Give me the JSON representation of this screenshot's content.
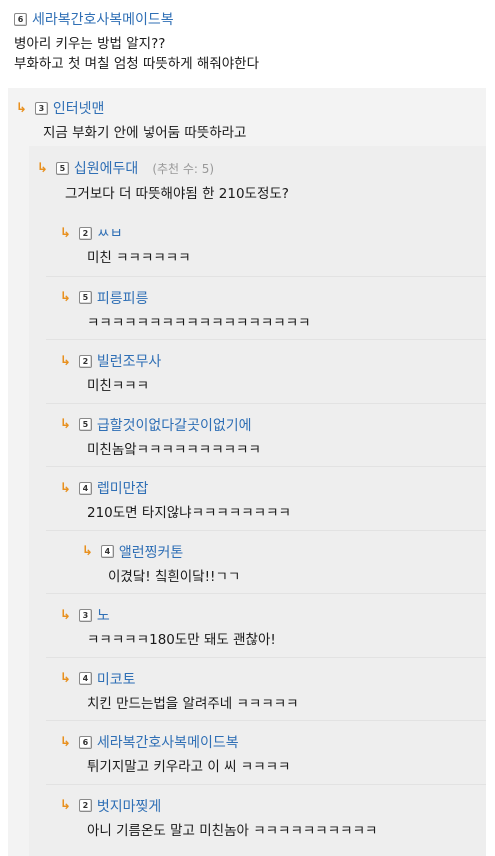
{
  "post": {
    "level": "6",
    "author": "세라복간호사복메이드복",
    "lines": [
      "병아리 키우는 방법 알지??",
      "부화하고 첫 며칠 엄청 따뜻하게 해줘야한다"
    ]
  },
  "reply": {
    "level": "3",
    "author": "인터넷맨",
    "text": "지금 부화기 안에 넣어둠 따뜻하라고"
  },
  "reply2": {
    "level": "5",
    "author": "십원에두대",
    "score": "(추천 수: 5)",
    "text": "그거보다 더 따뜻해야됨 한 210도정도?"
  },
  "replies": [
    {
      "level": "2",
      "author": "ㅆㅂ",
      "text": "미친 ㅋㅋㅋㅋㅋㅋ"
    },
    {
      "level": "5",
      "author": "피릉피릉",
      "text": "ㅋㅋㅋㅋㅋㅋㅋㅋㅋㅋㅋㅋㅋㅋㅋㅋㅋㅋ"
    },
    {
      "level": "2",
      "author": "빌런조무사",
      "text": "미친ㅋㅋㅋ"
    },
    {
      "level": "5",
      "author": "급할것이없다갈곳이없기에",
      "text": "미친놈앜ㅋㅋㅋㅋㅋㅋㅋㅋㅋㅋ"
    },
    {
      "level": "4",
      "author": "렙미만잡",
      "text": "210도면 타지않냐ㅋㅋㅋㅋㅋㅋㅋㅋ"
    },
    {
      "level": "4",
      "author": "앨런찡커톤",
      "text": "이겼닼! 칰흰이닼!!ㄱㄱ",
      "nested": true
    },
    {
      "level": "3",
      "author": "노",
      "text": "ㅋㅋㅋㅋㅋ180도만 돼도 괜찮아!"
    },
    {
      "level": "4",
      "author": "미코토",
      "text": "치킨 만드는법을 알려주네  ㅋㅋㅋㅋㅋ"
    },
    {
      "level": "6",
      "author": "세라복간호사복메이드복",
      "text": "튀기지말고 키우라고 이 씨 ㅋㅋㅋㅋ"
    },
    {
      "level": "2",
      "author": "벗지마찢게",
      "text": "아니 기름온도 말고 미친놈아 ㅋㅋㅋㅋㅋㅋㅋㅋㅋㅋ"
    }
  ]
}
